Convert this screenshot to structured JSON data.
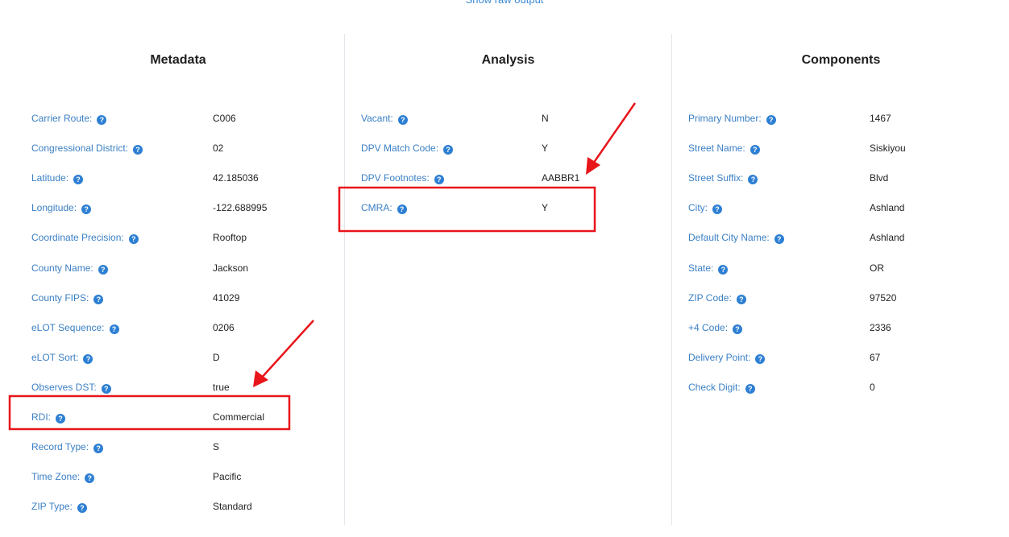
{
  "show_raw_output": "Show raw output",
  "metadata": {
    "title": "Metadata",
    "rows": [
      {
        "label": "Carrier Route:",
        "value": "C006"
      },
      {
        "label": "Congressional District:",
        "value": "02"
      },
      {
        "label": "Latitude:",
        "value": "42.185036"
      },
      {
        "label": "Longitude:",
        "value": "-122.688995"
      },
      {
        "label": "Coordinate Precision:",
        "value": "Rooftop"
      },
      {
        "label": "County Name:",
        "value": "Jackson"
      },
      {
        "label": "County FIPS:",
        "value": "41029"
      },
      {
        "label": "eLOT Sequence:",
        "value": "0206"
      },
      {
        "label": "eLOT Sort:",
        "value": "D"
      },
      {
        "label": "Observes DST:",
        "value": "true"
      },
      {
        "label": "RDI:",
        "value": "Commercial"
      },
      {
        "label": "Record Type:",
        "value": "S"
      },
      {
        "label": "Time Zone:",
        "value": "Pacific"
      },
      {
        "label": "ZIP Type:",
        "value": "Standard"
      }
    ]
  },
  "analysis": {
    "title": "Analysis",
    "rows": [
      {
        "label": "Vacant:",
        "value": "N"
      },
      {
        "label": "DPV Match Code:",
        "value": "Y"
      },
      {
        "label": "DPV Footnotes:",
        "value": "AABBR1"
      },
      {
        "label": "CMRA:",
        "value": "Y"
      }
    ]
  },
  "components": {
    "title": "Components",
    "rows": [
      {
        "label": "Primary Number:",
        "value": "1467"
      },
      {
        "label": "Street Name:",
        "value": "Siskiyou"
      },
      {
        "label": "Street Suffix:",
        "value": "Blvd"
      },
      {
        "label": "City:",
        "value": "Ashland"
      },
      {
        "label": "Default City Name:",
        "value": "Ashland"
      },
      {
        "label": "State:",
        "value": "OR"
      },
      {
        "label": "ZIP Code:",
        "value": "97520"
      },
      {
        "label": "+4 Code:",
        "value": "2336"
      },
      {
        "label": "Delivery Point:",
        "value": "67"
      },
      {
        "label": "Check Digit:",
        "value": "0"
      }
    ]
  },
  "help_glyph": "?",
  "colors": {
    "label": "#3a7fc4",
    "help_icon": "#2d7fd3",
    "annotation": "#e8151b",
    "divider": "#e3e6ea"
  },
  "icons": {
    "help": "question-circle-icon",
    "annotation_arrow": "red-arrow-icon"
  }
}
